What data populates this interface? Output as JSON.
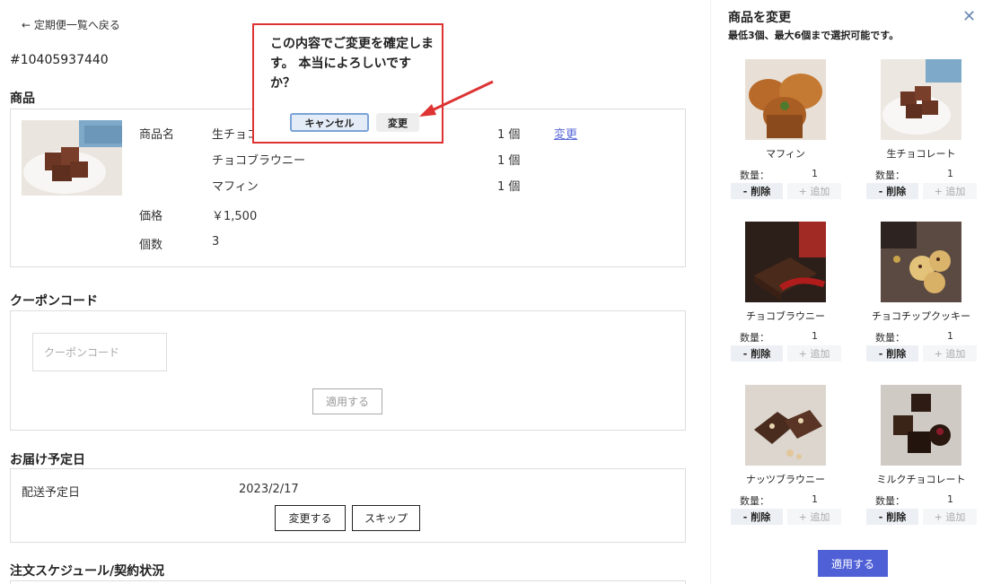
{
  "back_link": "← 定期便一覧へ戻る",
  "order_id": "#10405937440",
  "product_section": {
    "title": "商品",
    "name_label": "商品名",
    "items": [
      {
        "name": "生チョコ",
        "qty": "1 個"
      },
      {
        "name": "チョコブラウニー",
        "qty": "1 個"
      },
      {
        "name": "マフィン",
        "qty": "1 個"
      }
    ],
    "change_link": "変更",
    "price_label": "価格",
    "price": "￥1,500",
    "count_label": "個数",
    "count": "3"
  },
  "coupon_section": {
    "title": "クーポンコード",
    "placeholder": "クーポンコード",
    "apply_button": "適用する"
  },
  "delivery_section": {
    "title": "お届け予定日",
    "date_label": "配送予定日",
    "date": "2023/2/17",
    "change_button": "変更する",
    "skip_button": "スキップ"
  },
  "schedule_section": {
    "title": "注文スケジュール/契約状況"
  },
  "confirm_popup": {
    "message": "この内容でご変更を確定します。 本当によろしいですか？",
    "cancel": "キャンセル",
    "ok": "変更"
  },
  "panel": {
    "title": "商品を変更",
    "subtitle": "最低3個、最大6個まで選択可能です。",
    "qty_label": "数量：",
    "delete_label": "- 削除",
    "add_label": "+ 追加",
    "apply_button": "適用する",
    "products": [
      {
        "name": "マフィン",
        "qty": "1"
      },
      {
        "name": "生チョコレート",
        "qty": "1"
      },
      {
        "name": "チョコブラウニー",
        "qty": "1"
      },
      {
        "name": "チョコチップクッキー",
        "qty": "1"
      },
      {
        "name": "ナッツブラウニー",
        "qty": "1"
      },
      {
        "name": "ミルクチョコレート",
        "qty": "1"
      }
    ]
  },
  "colors": {
    "accent": "#4f5fd6",
    "link": "#5a6ad8",
    "highlight": "#dd3333"
  }
}
